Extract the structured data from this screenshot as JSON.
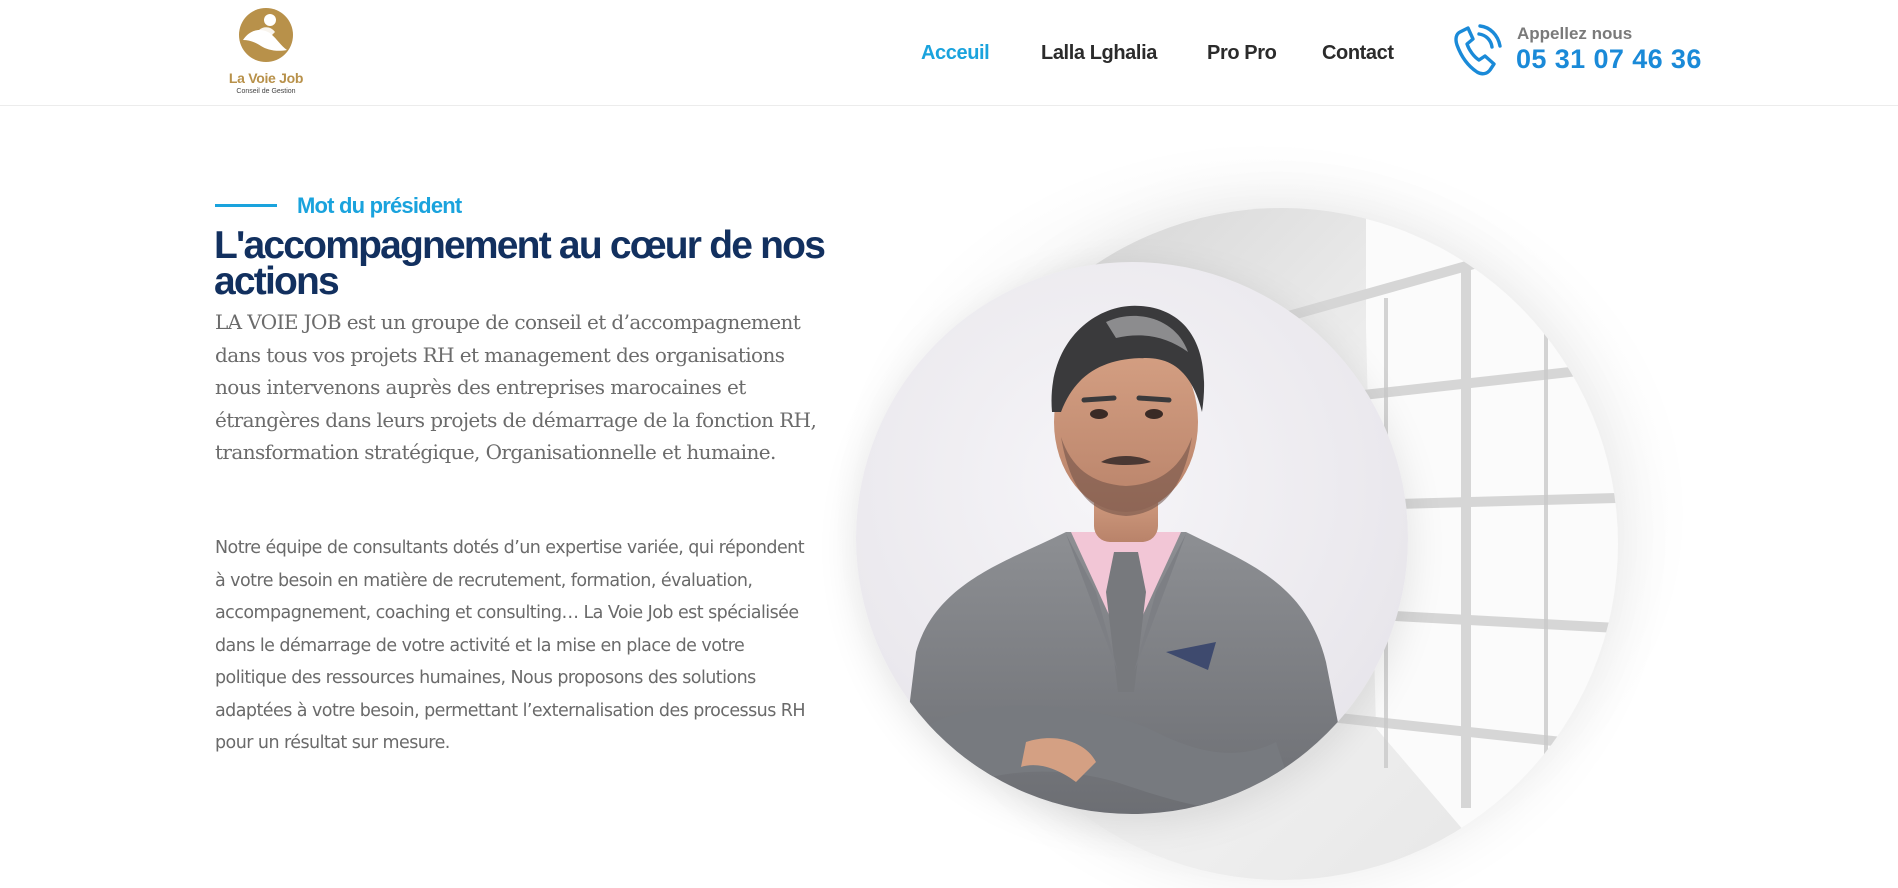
{
  "brand": {
    "name": "La Voie Job",
    "tagline": "Conseil de Gestion",
    "gold": "#b8914a"
  },
  "nav": {
    "items": [
      {
        "label": "Acceuil",
        "active": true
      },
      {
        "label": "Lalla Lghalia",
        "active": false
      },
      {
        "label": "Pro Pro",
        "active": false
      },
      {
        "label": "Contact",
        "active": false
      }
    ]
  },
  "phone": {
    "label": "Appellez nous",
    "number": "05 31 07 46 36",
    "icon": "phone-icon"
  },
  "section": {
    "eyebrow": "Mot du président",
    "headline": "L'accompagnement au cœur de nos actions",
    "lead": "LA VOIE JOB est un groupe de conseil et d’accompagnement dans tous vos projets RH et management des organisations nous intervenons auprès des entreprises marocaines et étrangères dans leurs projets de démarrage de la fonction RH, transformation stratégique, Organisationnelle et humaine.",
    "body": "Notre équipe de consultants dotés d’un expertise variée, qui répondent à votre besoin en matière de recrutement, formation, évaluation, accompagnement, coaching et consulting… La Voie Job est spécialisée dans le démarrage de votre activité et la mise en place de votre politique des ressources humaines, Nous proposons des solutions adaptées à votre besoin, permettant l’externalisation des processus RH pour un résultat sur mesure."
  },
  "colors": {
    "accent": "#1aa3dd",
    "phone": "#1a8ad8",
    "headline": "#12305f"
  }
}
